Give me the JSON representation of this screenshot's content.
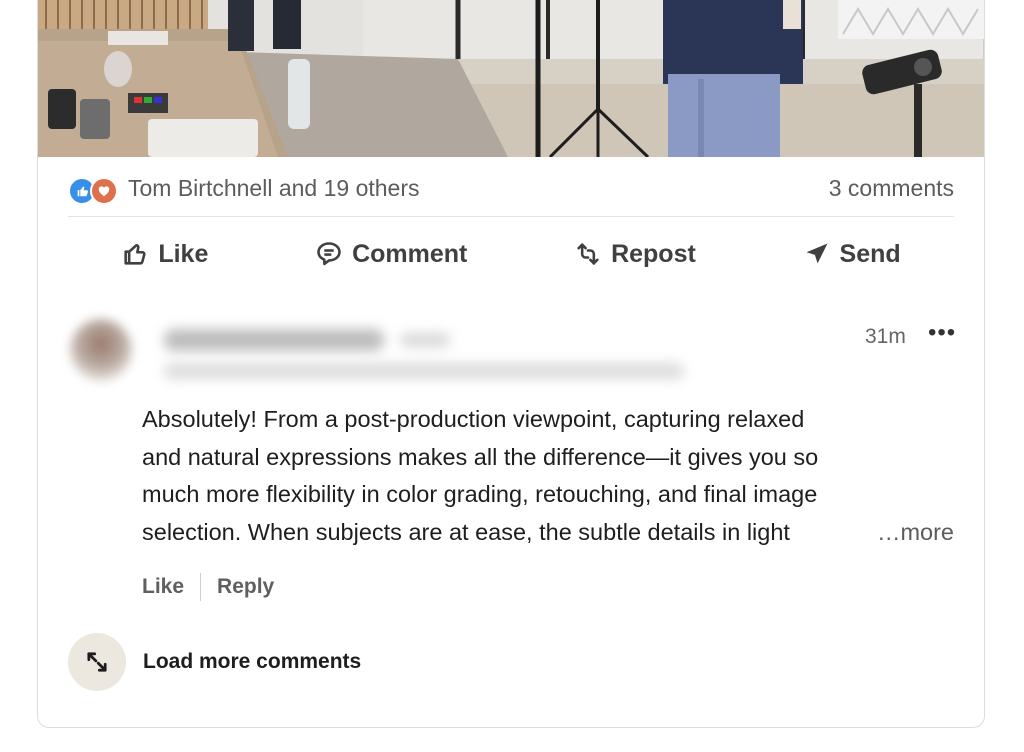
{
  "social": {
    "reactors_text": "Tom Birtchnell and 19 others",
    "comments_count": "3 comments",
    "reaction_icons": [
      "like-reaction",
      "love-reaction"
    ]
  },
  "actions": {
    "like": "Like",
    "comment": "Comment",
    "repost": "Repost",
    "send": "Send"
  },
  "comment": {
    "timestamp": "31m",
    "more_menu": "•••",
    "lines": [
      "Absolutely! From a post-production viewpoint, capturing relaxed",
      "and natural expressions makes all the difference—it gives you so",
      "much more flexibility in color grading, retouching, and final image",
      "selection. When subjects are at ease, the subtle details in light"
    ],
    "see_more": "…more",
    "like_label": "Like",
    "reply_label": "Reply"
  },
  "load_more": {
    "label": "Load more comments"
  },
  "colors": {
    "accent_like": "#378fe9",
    "accent_love": "#df704d",
    "text_secondary": "#5c5c5c"
  }
}
